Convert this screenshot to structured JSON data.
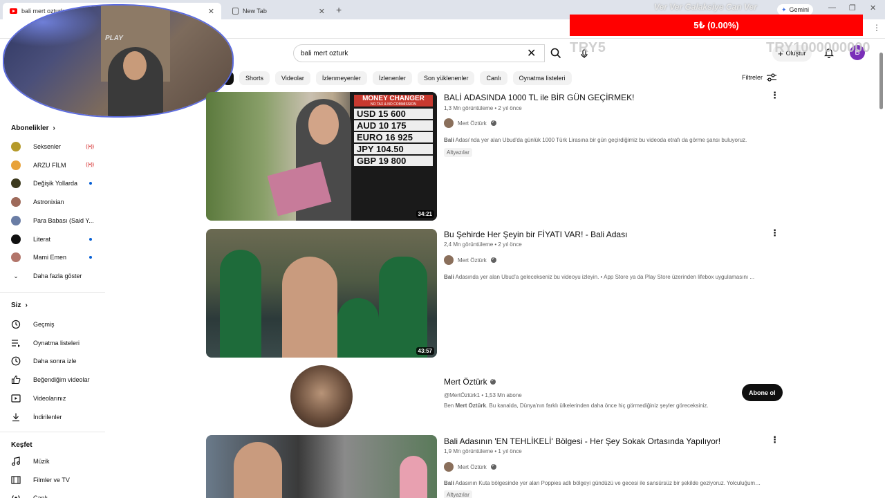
{
  "browser": {
    "tabs": [
      {
        "title": "bali mert ozturk - YouTube"
      },
      {
        "title": "New Tab"
      }
    ],
    "new_tab": "+",
    "gemini": "Gemini",
    "window_controls": [
      "—",
      "❐",
      "✕"
    ]
  },
  "overlay": {
    "ticker": "Ver Ver Galaksiye Can Ver",
    "donation": "5₺ (0.00%)",
    "try_small": "TRY5",
    "try_big": "TRY1000000000",
    "webcam_label": "PLAY"
  },
  "header": {
    "search_value": "bali mert ozturk",
    "create_label": "Oluştur",
    "avatar_letter": "B"
  },
  "chips": [
    "Shorts",
    "Videolar",
    "İzlenmeyenler",
    "İzlenenler",
    "Son yüklenenler",
    "Canlı",
    "Oynatma listeleri"
  ],
  "filters_label": "Filtreler",
  "sidebar": {
    "subscriptions_title": "Abonelikler",
    "subscriptions": [
      {
        "label": "Seksenler",
        "status": "live",
        "color": "#b59a2a"
      },
      {
        "label": "ARZU FİLM",
        "status": "live",
        "color": "#e8a23a"
      },
      {
        "label": "Değişik Yollarda",
        "status": "dot",
        "color": "#3d3a1e"
      },
      {
        "label": "Astronixian",
        "status": "",
        "color": "#9e6a5a"
      },
      {
        "label": "Para Babası (Said Y...",
        "status": "",
        "color": "#6a7da5"
      },
      {
        "label": "Literat",
        "status": "dot",
        "color": "#111111"
      },
      {
        "label": "Mami Emen",
        "status": "dot",
        "color": "#b2756a"
      }
    ],
    "show_more": "Daha fazla göster",
    "you_title": "Siz",
    "you_items": [
      {
        "label": "Geçmiş",
        "icon": "history-icon"
      },
      {
        "label": "Oynatma listeleri",
        "icon": "playlists-icon"
      },
      {
        "label": "Daha sonra izle",
        "icon": "clock-icon"
      },
      {
        "label": "Beğendiğim videolar",
        "icon": "thumbs-up-icon"
      },
      {
        "label": "Videolarınız",
        "icon": "your-videos-icon"
      },
      {
        "label": "İndirilenler",
        "icon": "download-icon"
      }
    ],
    "explore_title": "Keşfet",
    "explore_items": [
      {
        "label": "Müzik",
        "icon": "music-icon"
      },
      {
        "label": "Filmler ve TV",
        "icon": "film-icon"
      },
      {
        "label": "Canlı",
        "icon": "live-icon"
      }
    ]
  },
  "results": [
    {
      "title": "BALİ ADASINDA 1000 TL ile BİR GÜN GEÇİRMEK!",
      "meta": "1,3 Mn görüntüleme • 2 yıl önce",
      "channel": "Mert Öztürk",
      "desc_bold": "Bali",
      "desc": " Adası'nda yer alan Ubud'da günlük 1000 Türk Lirasına bir gün geçirdiğimiz bu videoda etrafı da görme şansı buluyoruz.",
      "badge": "Altyazılar",
      "duration": "34:21",
      "sign_lines": [
        "MONEY CHANGER",
        "NO TAX & NO COMMISSION",
        "USD 15 600",
        "AUD 10 175",
        "EURO 16 925",
        "JPY 104.50",
        "GBP 19 800"
      ]
    },
    {
      "title": "Bu Şehirde Her Şeyin bir FİYATI VAR! - Bali Adası",
      "meta": "2,4 Mn görüntüleme • 2 yıl önce",
      "channel": "Mert Öztürk",
      "desc_bold": "Bali",
      "desc": " Adasında yer alan Ubud'a gelecekseniz bu videoyu izleyin. • App Store ya da Play Store üzerinden lifebox uygulamasını ...",
      "badge": "",
      "duration": "43:57"
    },
    {
      "title": "Bali Adasının 'EN TEHLİKELİ' Bölgesi - Her Şey Sokak Ortasında Yapılıyor!",
      "meta": "1,9 Mn görüntüleme • 1 yıl önce",
      "channel": "Mert Öztürk",
      "desc_bold": "Bali",
      "desc": " Adasının Kuta bölgesinde yer alan Poppies adlı bölgeyi gündüzü ve gecesi ile sansürsüz bir şekilde geziyoruz. Yolculuğuma ...",
      "badge": "Altyazılar",
      "duration": ""
    }
  ],
  "channel_card": {
    "name": "Mert Öztürk",
    "handle_subs": "@MertÖztürk1 • 1,53 Mn abone",
    "desc_prefix": "Ben ",
    "desc_bold": "Mert Öztürk",
    "desc": ". Bu kanalda, Dünya'nın farklı ülkelerinden daha önce hiç görmediğiniz şeyler göreceksiniz.",
    "subscribe": "Abone ol"
  }
}
